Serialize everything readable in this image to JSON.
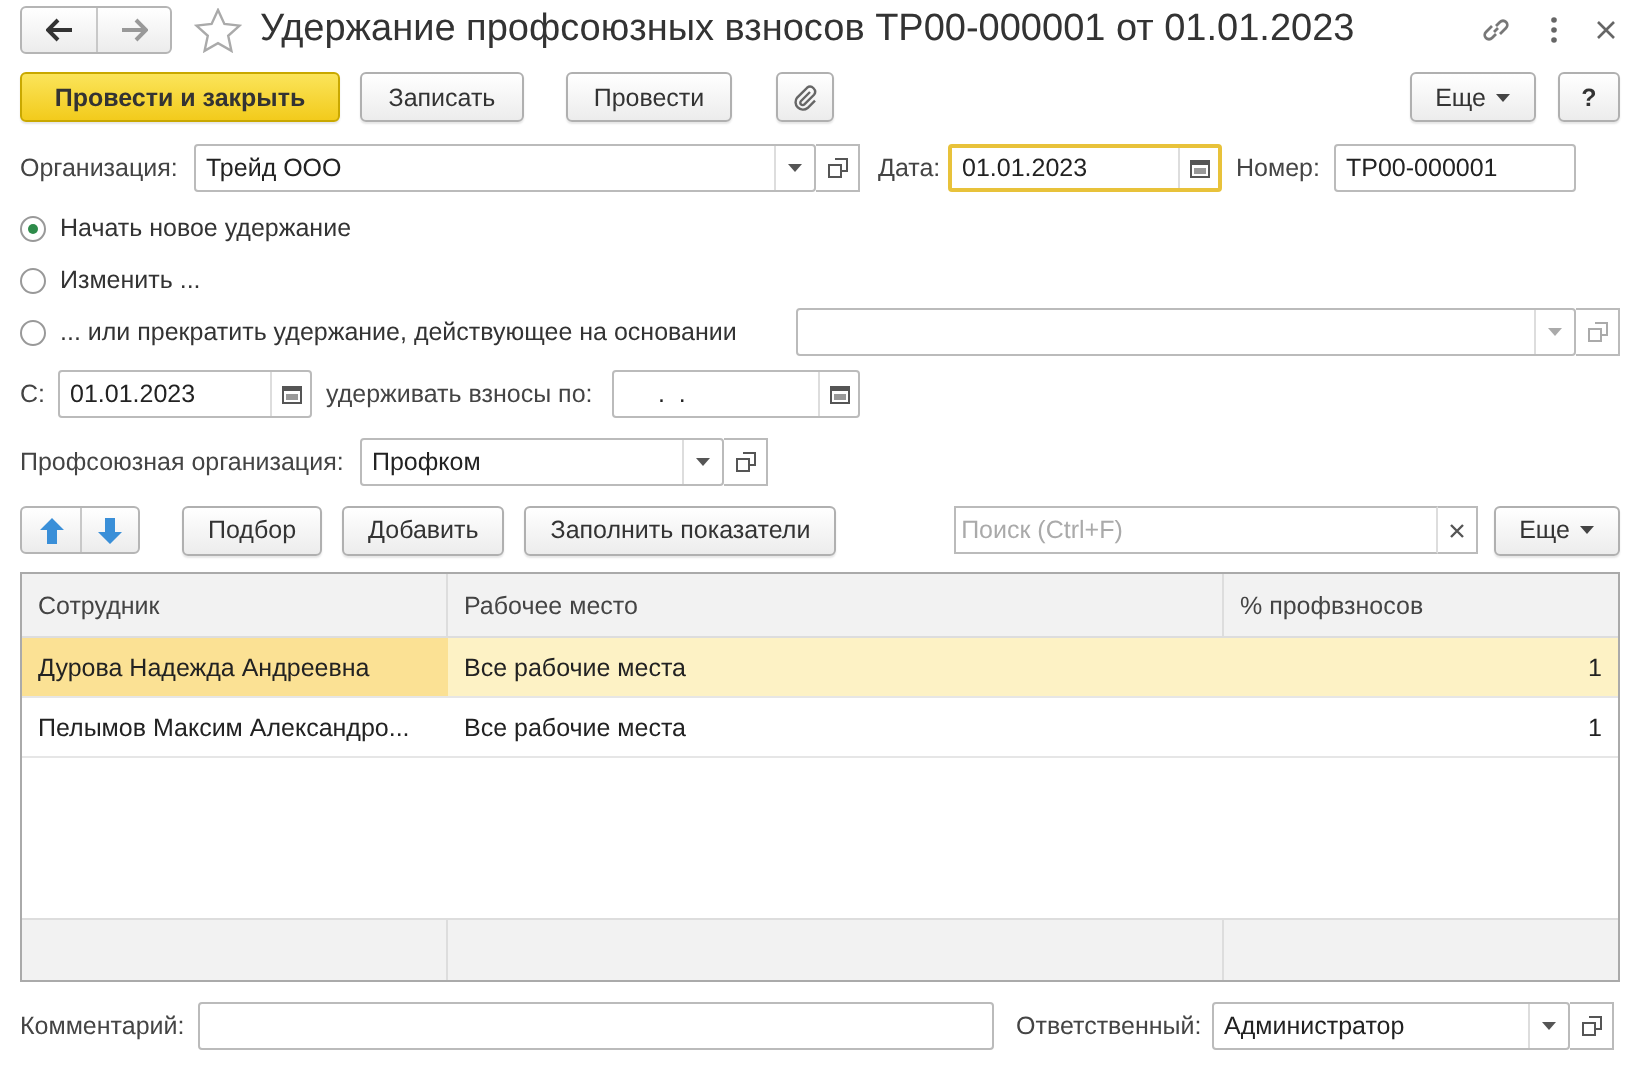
{
  "window": {
    "title": "Удержание профсоюзных взносов ТР00-000001 от 01.01.2023"
  },
  "toolbar": {
    "buttons": [
      {
        "label": "Провести и закрыть",
        "kind": "primary"
      },
      {
        "label": "Записать",
        "kind": "default"
      },
      {
        "label": "Провести",
        "kind": "default"
      }
    ],
    "more": "Еще",
    "help": "?"
  },
  "organization": {
    "label": "Организация:",
    "value": "Трейд ООО"
  },
  "date": {
    "label": "Дата:",
    "value": "01.01.2023",
    "focused": true
  },
  "number": {
    "label": "Номер:",
    "value": "ТР00-000001"
  },
  "radios": [
    {
      "label": "Начать новое удержание",
      "selected": true
    },
    {
      "label": "Изменить ...",
      "selected": false
    },
    {
      "label": "... или прекратить удержание, действующее на основании",
      "selected": false
    }
  ],
  "period": {
    "from_label": "С:",
    "from": "01.01.2023",
    "to_label": "удерживать взносы по:",
    "to": ".  ."
  },
  "union": {
    "label": "Профсоюзная организация:",
    "value": "Профком"
  },
  "table_toolbar": {
    "buttons": [
      "Подбор",
      "Добавить",
      "Заполнить показатели"
    ],
    "search": {
      "placeholder": "Поиск (Ctrl+F)"
    },
    "more": "Еще"
  },
  "table": {
    "columns": [
      "Сотрудник",
      "Рабочее место",
      "% профвзносов"
    ],
    "rows": [
      {
        "cells": [
          "Дурова Надежда Андреевна",
          "Все рабочие места",
          "1"
        ],
        "selected": true
      },
      {
        "cells": [
          "Пелымов Максим Александро...",
          "Все рабочие места",
          "1"
        ],
        "selected": false
      }
    ]
  },
  "comment": {
    "label": "Комментарий:"
  },
  "responsible": {
    "label": "Ответственный:",
    "value": "Администратор"
  }
}
